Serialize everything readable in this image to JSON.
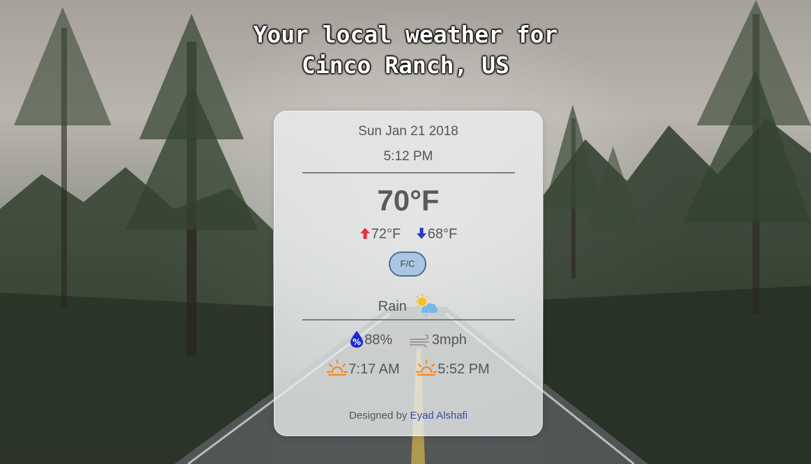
{
  "header": {
    "title_line1": "Your local weather for",
    "title_line2": "Cinco Ranch, US"
  },
  "weather": {
    "date": "Sun Jan 21 2018",
    "time": "5:12 PM",
    "temperature": "70°F",
    "high": "72°F",
    "low": "68°F",
    "unit_toggle_label": "F/C",
    "condition": "Rain",
    "condition_icon": "partly-cloudy-rain-icon",
    "humidity": "88%",
    "wind": "3mph",
    "sunrise": "7:17 AM",
    "sunset": "5:52 PM"
  },
  "footer": {
    "designed_by": "Designed by",
    "author": "Eyad Alshafi"
  },
  "colors": {
    "high_arrow": "#e8303a",
    "low_arrow": "#2838c8",
    "humidity_drop": "#1a2bd0",
    "sun_icon": "#f08a1e",
    "toggle_bg": "#a9c7e4",
    "link": "#3a4ca8"
  }
}
